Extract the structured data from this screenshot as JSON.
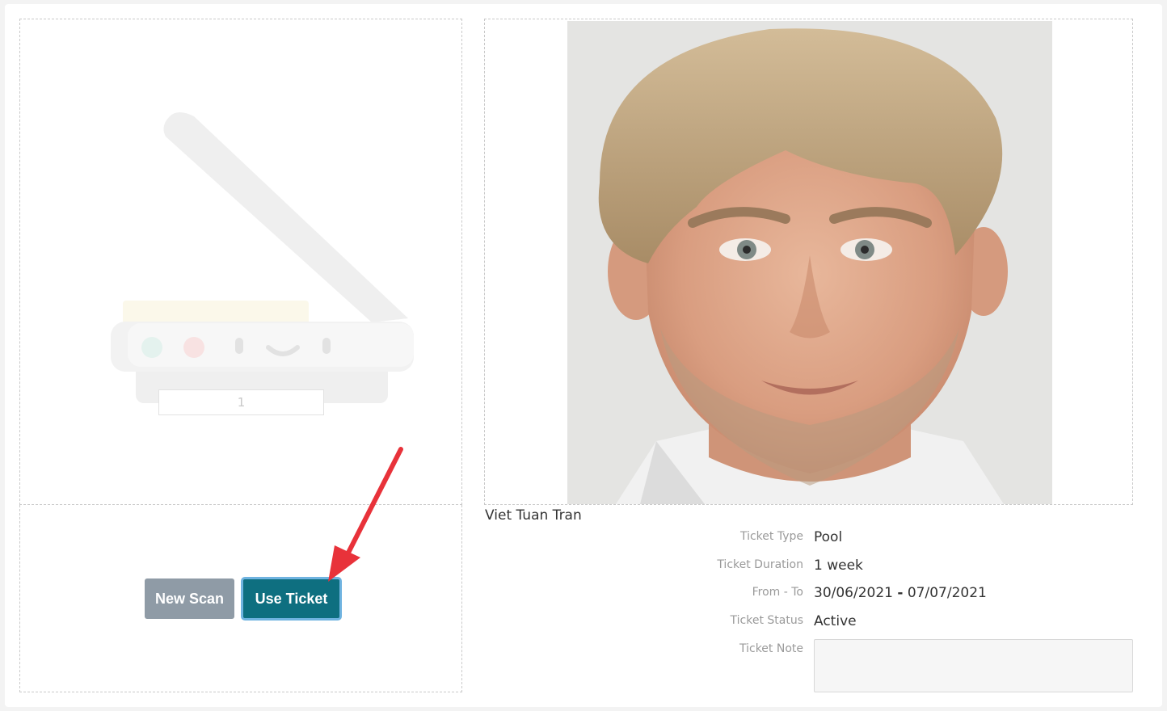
{
  "scanner": {
    "page_counter": "1"
  },
  "actions": {
    "new_scan_label": "New Scan",
    "use_ticket_label": "Use Ticket"
  },
  "person": {
    "name": "Viet Tuan Tran"
  },
  "ticket": {
    "type_label": "Ticket Type",
    "type_value": "Pool",
    "duration_label": "Ticket Duration",
    "duration_value": "1 week",
    "range_label": "From - To",
    "from_value": "30/06/2021",
    "range_separator": "-",
    "to_value": "07/07/2021",
    "status_label": "Ticket Status",
    "status_value": "Active",
    "note_label": "Ticket Note",
    "note_value": ""
  },
  "colors": {
    "use_ticket_bg": "#0e6f80",
    "new_scan_bg": "#8f9ba6",
    "focus_ring": "#6fb3e0",
    "annotation_arrow": "#e8323a"
  },
  "icons": {
    "scanner": "scanner-icon",
    "arrow": "annotation-arrow-icon",
    "photo": "profile-photo"
  }
}
